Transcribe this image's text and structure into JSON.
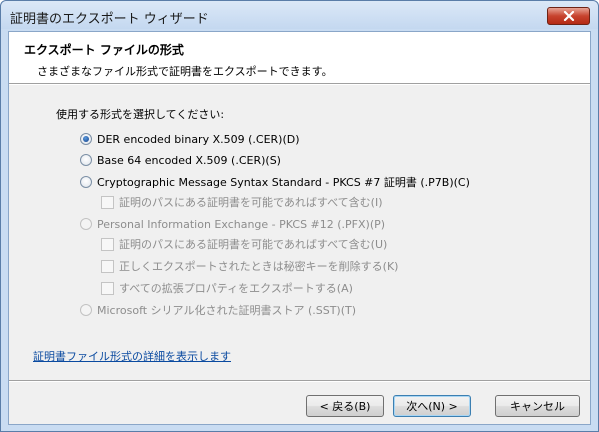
{
  "window": {
    "title": "証明書のエクスポート ウィザード"
  },
  "header": {
    "title": "エクスポート ファイルの形式",
    "subtitle": "さまざまなファイル形式で証明書をエクスポートできます。"
  },
  "prompt": "使用する形式を選択してください:",
  "options": [
    {
      "label": "DER encoded binary X.509 (.CER)(D)",
      "checked": true,
      "enabled": true
    },
    {
      "label": "Base 64 encoded X.509 (.CER)(S)",
      "checked": false,
      "enabled": true
    },
    {
      "label": "Cryptographic Message Syntax Standard - PKCS #7 証明書 (.P7B)(C)",
      "checked": false,
      "enabled": true
    },
    {
      "label": "証明のパスにある証明書を可能であればすべて含む(I)",
      "checked": false,
      "enabled": false
    },
    {
      "label": "Personal Information Exchange - PKCS #12 (.PFX)(P)",
      "checked": false,
      "enabled": false
    },
    {
      "label": "証明のパスにある証明書を可能であればすべて含む(U)",
      "checked": false,
      "enabled": false
    },
    {
      "label": "正しくエクスポートされたときは秘密キーを削除する(K)",
      "checked": false,
      "enabled": false
    },
    {
      "label": "すべての拡張プロパティをエクスポートする(A)",
      "checked": false,
      "enabled": false
    },
    {
      "label": "Microsoft シリアル化された証明書ストア (.SST)(T)",
      "checked": false,
      "enabled": false
    }
  ],
  "link": "証明書ファイル形式の詳細を表示します",
  "buttons": {
    "back": "< 戻る(B)",
    "next": "次へ(N) >",
    "cancel": "キャンセル"
  },
  "icons": {
    "close": "close-icon"
  }
}
